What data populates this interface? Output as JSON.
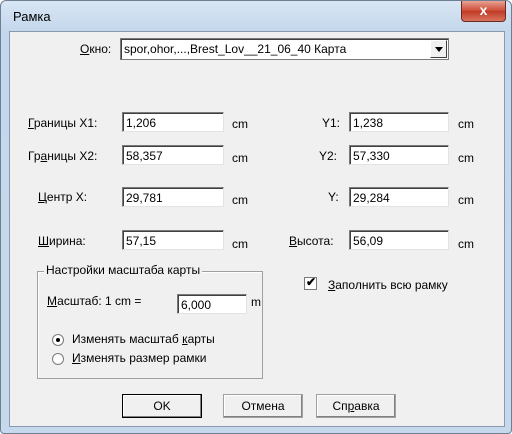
{
  "window": {
    "title": "Рамка",
    "close_glyph": "x"
  },
  "window_row": {
    "label_prefix": "",
    "label_key": "О",
    "label_rest": "кно:",
    "value": "spor,ohor,...,Brest_Lov__21_06_40 Карта"
  },
  "bounds1": {
    "label_key": "Г",
    "label_rest": "раницы X1:",
    "x1": "1,206",
    "unit_x": "cm",
    "y_label": "Y1:",
    "y1": "1,238",
    "unit_y": "cm"
  },
  "bounds2": {
    "label_prefix": "Гр",
    "label_key": "а",
    "label_rest": "ницы X2:",
    "x2": "58,357",
    "unit_x": "cm",
    "y_label": "Y2:",
    "y2": "57,330",
    "unit_y": "cm"
  },
  "center": {
    "label_key": "Ц",
    "label_rest": "ентр X:",
    "x": "29,781",
    "unit_x": "cm",
    "y_label": "Y:",
    "y": "29,284",
    "unit_y": "cm"
  },
  "size": {
    "width_key": "Ш",
    "width_rest": "ирина:",
    "width": "57,15",
    "unit_w": "cm",
    "height_key": "В",
    "height_rest": "ысота:",
    "height": "56,09",
    "unit_h": "cm"
  },
  "scale_group": {
    "title": "Настройки масштаба карты",
    "scale_key": "М",
    "scale_rest": "асштаб: 1 cm =",
    "scale_value": "6,000",
    "scale_unit": "m",
    "radio1_pre": "Изменять масштаб ",
    "radio1_key": "к",
    "radio1_post": "арты",
    "radio2_key": "И",
    "radio2_rest": "зменять размер рамки",
    "selected": "radio1"
  },
  "fill_frame": {
    "key": "З",
    "rest": "аполнить всю рамку",
    "checked": "✔"
  },
  "buttons": {
    "ok": "OK",
    "cancel": "Отмена",
    "help_pre": "Сп",
    "help_key": "р",
    "help_post": "авка"
  }
}
